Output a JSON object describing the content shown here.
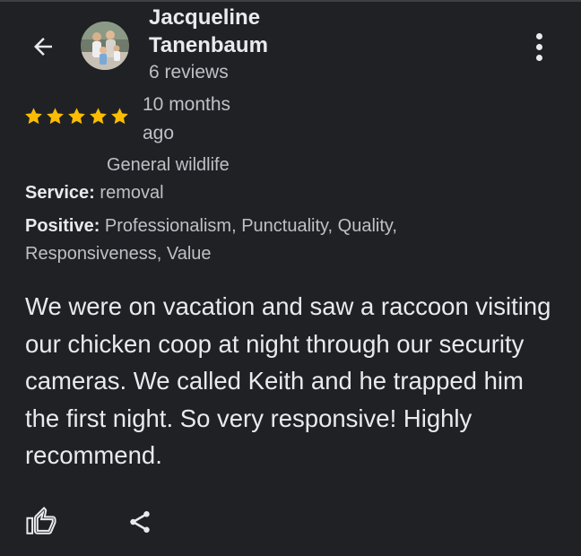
{
  "author": {
    "name": "Jacqueline Tanenbaum",
    "review_count": "6 reviews"
  },
  "review": {
    "rating": 5,
    "rating_max": 5,
    "time_ago": "10 months ago",
    "service_label": "Service:",
    "service_value_line1": "General wildlife",
    "service_value_line2": "removal",
    "positive_label": "Positive:",
    "positive_values": "Professionalism, Punctuality, Quality, Responsiveness, Value",
    "text": "We were on vacation and saw a raccoon visiting our chicken coop at night through our security cameras. We called Keith and he trapped him the first night. So very responsive! Highly recommend."
  },
  "icons": {
    "back": "arrow-back-icon",
    "more": "more-vert-icon",
    "star": "star-icon",
    "like": "thumb-up-icon",
    "share": "share-icon"
  },
  "colors": {
    "background": "#202124",
    "star": "#fbbc04",
    "text_primary": "#e8eaed",
    "text_secondary": "#bdc1c6"
  }
}
